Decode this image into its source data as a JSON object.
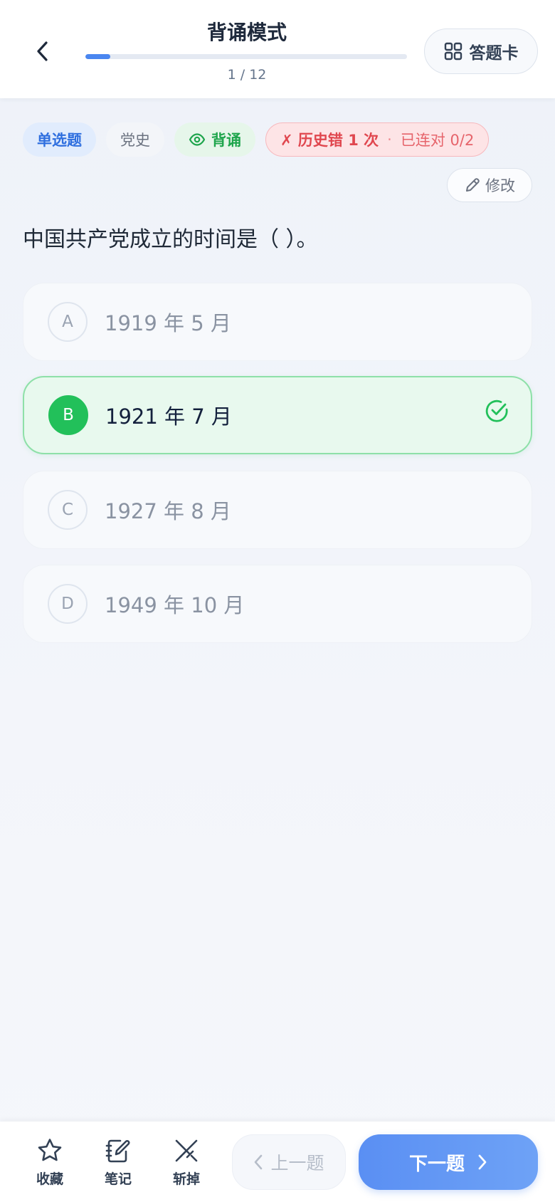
{
  "header": {
    "title": "背诵模式",
    "progress_text": "1 / 12",
    "progress_fraction": 0.077,
    "answer_card_label": "答题卡"
  },
  "tags": {
    "type": "单选题",
    "subject": "党史",
    "mode": "背诵",
    "error_main": "✗ 历史错 1 次",
    "error_dot": "·",
    "error_streak": "已连对 0/2"
  },
  "edit_label": "修改",
  "question": "中国共产党成立的时间是（ ）。",
  "options": [
    {
      "letter": "A",
      "text": "1919 年 5 月"
    },
    {
      "letter": "B",
      "text": "1921 年 7 月"
    },
    {
      "letter": "C",
      "text": "1927 年 8 月"
    },
    {
      "letter": "D",
      "text": "1949 年 10 月"
    }
  ],
  "correct_option": "B",
  "bottom": {
    "favorite_label": "收藏",
    "note_label": "笔记",
    "remove_label": "斩掉",
    "prev_label": "上一题",
    "next_label": "下一题"
  },
  "colors": {
    "accent": "#4a86f0",
    "correct": "#22c05a",
    "error": "#e0474f"
  }
}
